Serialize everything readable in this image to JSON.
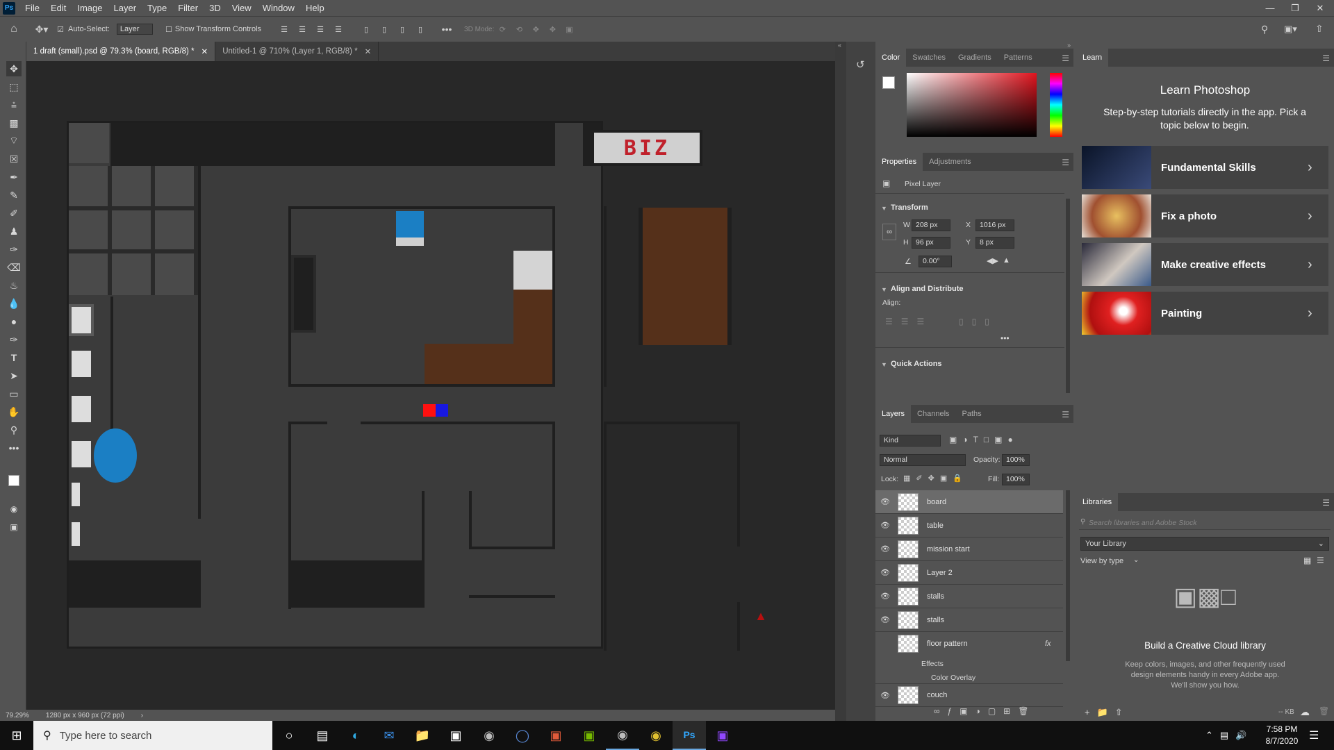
{
  "menubar": {
    "items": [
      "File",
      "Edit",
      "Image",
      "Layer",
      "Type",
      "Filter",
      "3D",
      "View",
      "Window",
      "Help"
    ]
  },
  "options": {
    "auto_select": "Auto-Select:",
    "layer_select": "Layer",
    "show_transform": "Show Transform Controls",
    "mode_3d": "3D Mode:"
  },
  "tabs": [
    {
      "label": "1 draft (small).psd @ 79.3% (board, RGB/8) *"
    },
    {
      "label": "Untitled-1 @ 710% (Layer 1, RGB/8) *"
    }
  ],
  "status": {
    "zoom": "79.29%",
    "size": "1280 px x 960 px (72 ppi)"
  },
  "canvas": {
    "sign_text": "BIZ"
  },
  "color_panel": {
    "tabs": [
      "Color",
      "Swatches",
      "Gradients",
      "Patterns"
    ]
  },
  "properties": {
    "tabs": [
      "Properties",
      "Adjustments"
    ],
    "kind": "Pixel Layer",
    "transform_title": "Transform",
    "w_label": "W",
    "w": "208 px",
    "h_label": "H",
    "h": "96 px",
    "x_label": "X",
    "x": "1016 px",
    "y_label": "Y",
    "y": "8 px",
    "angle": "0.00°",
    "align_title": "Align and Distribute",
    "align_label": "Align:",
    "quick_actions": "Quick Actions"
  },
  "layers": {
    "tabs": [
      "Layers",
      "Channels",
      "Paths"
    ],
    "kind": "Kind",
    "blend": "Normal",
    "opacity_label": "Opacity:",
    "opacity": "100%",
    "lock_label": "Lock:",
    "fill_label": "Fill:",
    "fill": "100%",
    "items": [
      {
        "name": "board",
        "visible": true
      },
      {
        "name": "table",
        "visible": true
      },
      {
        "name": "mission start",
        "visible": true
      },
      {
        "name": "Layer 2",
        "visible": true
      },
      {
        "name": "stalls",
        "visible": true
      },
      {
        "name": "stalls",
        "visible": true
      },
      {
        "name": "floor pattern",
        "visible": false
      },
      {
        "name": "couch",
        "visible": true
      }
    ],
    "effects": "Effects",
    "color_overlay": "Color Overlay",
    "fx": "fx"
  },
  "learn": {
    "tab": "Learn",
    "title": "Learn Photoshop",
    "subtitle": "Step-by-step tutorials directly in the app. Pick a topic below to begin.",
    "cards": [
      {
        "label": "Fundamental Skills"
      },
      {
        "label": "Fix a photo"
      },
      {
        "label": "Make creative effects"
      },
      {
        "label": "Painting"
      }
    ]
  },
  "libraries": {
    "tab": "Libraries",
    "search_placeholder": "Search libraries and Adobe Stock",
    "library": "Your Library",
    "view_by": "View by type",
    "heading": "Build a Creative Cloud library",
    "body": "Keep colors, images, and other frequently used design elements handy in every Adobe app. We'll show you how.",
    "kb": "-- KB"
  },
  "taskbar": {
    "search_placeholder": "Type here to search",
    "time": "7:58 PM",
    "date": "8/7/2020"
  }
}
